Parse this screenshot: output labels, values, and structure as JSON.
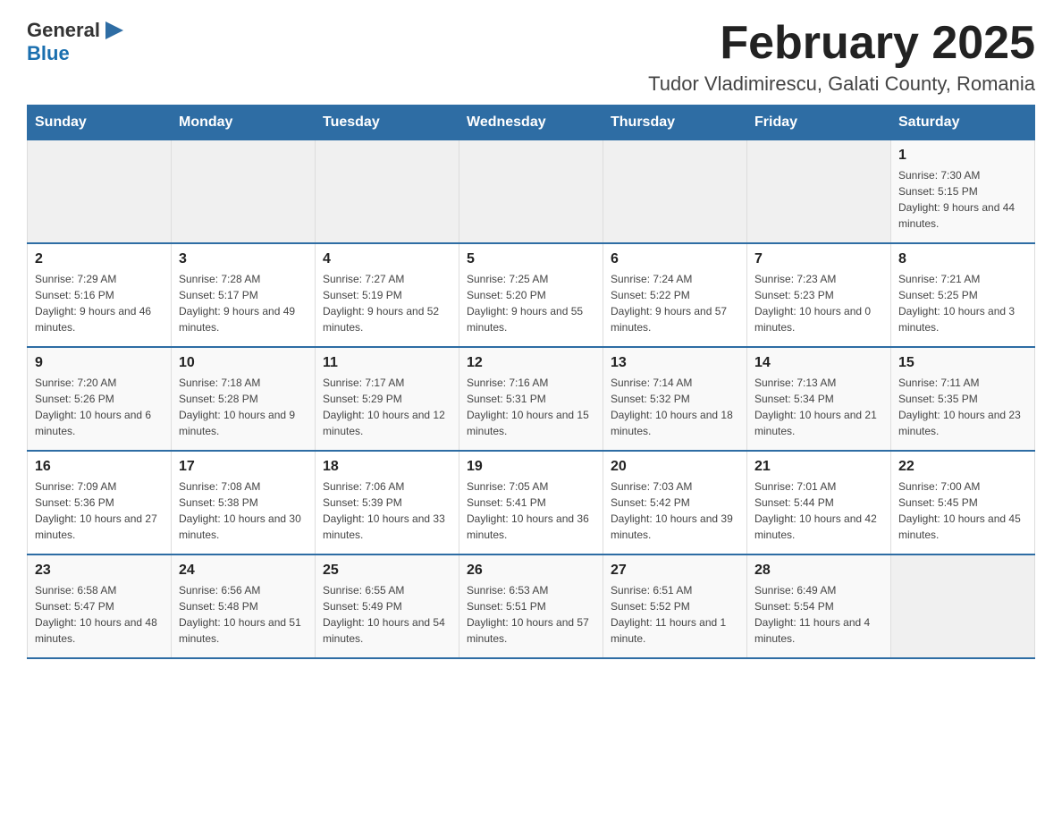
{
  "logo": {
    "general": "General",
    "blue": "Blue"
  },
  "header": {
    "title": "February 2025",
    "subtitle": "Tudor Vladimirescu, Galati County, Romania"
  },
  "days_of_week": [
    "Sunday",
    "Monday",
    "Tuesday",
    "Wednesday",
    "Thursday",
    "Friday",
    "Saturday"
  ],
  "weeks": [
    [
      {
        "day": "",
        "info": ""
      },
      {
        "day": "",
        "info": ""
      },
      {
        "day": "",
        "info": ""
      },
      {
        "day": "",
        "info": ""
      },
      {
        "day": "",
        "info": ""
      },
      {
        "day": "",
        "info": ""
      },
      {
        "day": "1",
        "info": "Sunrise: 7:30 AM\nSunset: 5:15 PM\nDaylight: 9 hours and 44 minutes."
      }
    ],
    [
      {
        "day": "2",
        "info": "Sunrise: 7:29 AM\nSunset: 5:16 PM\nDaylight: 9 hours and 46 minutes."
      },
      {
        "day": "3",
        "info": "Sunrise: 7:28 AM\nSunset: 5:17 PM\nDaylight: 9 hours and 49 minutes."
      },
      {
        "day": "4",
        "info": "Sunrise: 7:27 AM\nSunset: 5:19 PM\nDaylight: 9 hours and 52 minutes."
      },
      {
        "day": "5",
        "info": "Sunrise: 7:25 AM\nSunset: 5:20 PM\nDaylight: 9 hours and 55 minutes."
      },
      {
        "day": "6",
        "info": "Sunrise: 7:24 AM\nSunset: 5:22 PM\nDaylight: 9 hours and 57 minutes."
      },
      {
        "day": "7",
        "info": "Sunrise: 7:23 AM\nSunset: 5:23 PM\nDaylight: 10 hours and 0 minutes."
      },
      {
        "day": "8",
        "info": "Sunrise: 7:21 AM\nSunset: 5:25 PM\nDaylight: 10 hours and 3 minutes."
      }
    ],
    [
      {
        "day": "9",
        "info": "Sunrise: 7:20 AM\nSunset: 5:26 PM\nDaylight: 10 hours and 6 minutes."
      },
      {
        "day": "10",
        "info": "Sunrise: 7:18 AM\nSunset: 5:28 PM\nDaylight: 10 hours and 9 minutes."
      },
      {
        "day": "11",
        "info": "Sunrise: 7:17 AM\nSunset: 5:29 PM\nDaylight: 10 hours and 12 minutes."
      },
      {
        "day": "12",
        "info": "Sunrise: 7:16 AM\nSunset: 5:31 PM\nDaylight: 10 hours and 15 minutes."
      },
      {
        "day": "13",
        "info": "Sunrise: 7:14 AM\nSunset: 5:32 PM\nDaylight: 10 hours and 18 minutes."
      },
      {
        "day": "14",
        "info": "Sunrise: 7:13 AM\nSunset: 5:34 PM\nDaylight: 10 hours and 21 minutes."
      },
      {
        "day": "15",
        "info": "Sunrise: 7:11 AM\nSunset: 5:35 PM\nDaylight: 10 hours and 23 minutes."
      }
    ],
    [
      {
        "day": "16",
        "info": "Sunrise: 7:09 AM\nSunset: 5:36 PM\nDaylight: 10 hours and 27 minutes."
      },
      {
        "day": "17",
        "info": "Sunrise: 7:08 AM\nSunset: 5:38 PM\nDaylight: 10 hours and 30 minutes."
      },
      {
        "day": "18",
        "info": "Sunrise: 7:06 AM\nSunset: 5:39 PM\nDaylight: 10 hours and 33 minutes."
      },
      {
        "day": "19",
        "info": "Sunrise: 7:05 AM\nSunset: 5:41 PM\nDaylight: 10 hours and 36 minutes."
      },
      {
        "day": "20",
        "info": "Sunrise: 7:03 AM\nSunset: 5:42 PM\nDaylight: 10 hours and 39 minutes."
      },
      {
        "day": "21",
        "info": "Sunrise: 7:01 AM\nSunset: 5:44 PM\nDaylight: 10 hours and 42 minutes."
      },
      {
        "day": "22",
        "info": "Sunrise: 7:00 AM\nSunset: 5:45 PM\nDaylight: 10 hours and 45 minutes."
      }
    ],
    [
      {
        "day": "23",
        "info": "Sunrise: 6:58 AM\nSunset: 5:47 PM\nDaylight: 10 hours and 48 minutes."
      },
      {
        "day": "24",
        "info": "Sunrise: 6:56 AM\nSunset: 5:48 PM\nDaylight: 10 hours and 51 minutes."
      },
      {
        "day": "25",
        "info": "Sunrise: 6:55 AM\nSunset: 5:49 PM\nDaylight: 10 hours and 54 minutes."
      },
      {
        "day": "26",
        "info": "Sunrise: 6:53 AM\nSunset: 5:51 PM\nDaylight: 10 hours and 57 minutes."
      },
      {
        "day": "27",
        "info": "Sunrise: 6:51 AM\nSunset: 5:52 PM\nDaylight: 11 hours and 1 minute."
      },
      {
        "day": "28",
        "info": "Sunrise: 6:49 AM\nSunset: 5:54 PM\nDaylight: 11 hours and 4 minutes."
      },
      {
        "day": "",
        "info": ""
      }
    ]
  ]
}
